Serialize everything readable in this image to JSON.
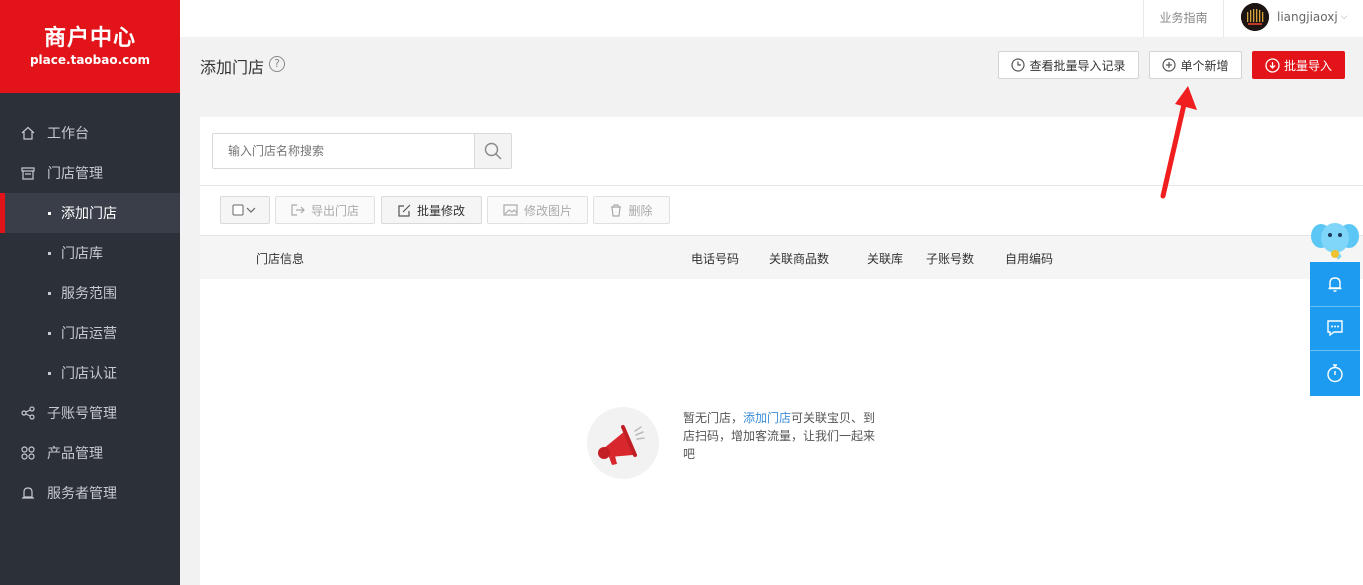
{
  "logo": {
    "title": "商户中心",
    "subtitle": "place.taobao.com"
  },
  "sidebar": {
    "items": [
      {
        "label": "工作台",
        "icon": "home-icon"
      },
      {
        "label": "门店管理",
        "icon": "store-icon"
      },
      {
        "label": "添加门店",
        "sub": true,
        "active": true
      },
      {
        "label": "门店库",
        "sub": true
      },
      {
        "label": "服务范围",
        "sub": true
      },
      {
        "label": "门店运营",
        "sub": true
      },
      {
        "label": "门店认证",
        "sub": true
      },
      {
        "label": "子账号管理",
        "icon": "share-icon"
      },
      {
        "label": "产品管理",
        "icon": "grid-icon"
      },
      {
        "label": "服务者管理",
        "icon": "bell-icon"
      }
    ]
  },
  "topbar": {
    "guide": "业务指南",
    "username": "liangjiaoxj"
  },
  "pagehead": {
    "title": "添加门店",
    "help": "?",
    "view_records": "查看批量导入记录",
    "add_single": "单个新增",
    "batch_import": "批量导入"
  },
  "search": {
    "placeholder": "输入门店名称搜索"
  },
  "toolbar": {
    "export": "导出门店",
    "batch_edit": "批量修改",
    "edit_image": "修改图片",
    "delete": "删除"
  },
  "table": {
    "columns": [
      "门店信息",
      "电话号码",
      "关联商品数",
      "关联库",
      "子账号数",
      "自用编码"
    ]
  },
  "empty": {
    "prefix": "暂无门店，",
    "link": "添加门店",
    "suffix": "可关联宝贝、到店扫码，增加客流量，让我们一起来吧"
  },
  "colors": {
    "brand_red": "#e2141a",
    "sidebar": "#2c3039",
    "float_blue": "#1d9bf0",
    "link": "#3b8ed8"
  }
}
